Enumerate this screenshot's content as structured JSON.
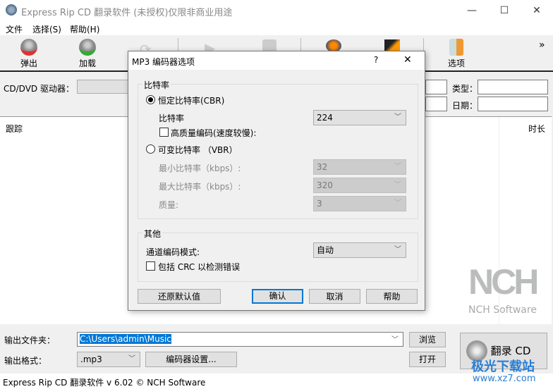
{
  "window": {
    "title": "Express Rip CD 翻录软件 (未授权)仅限非商业用途",
    "minimize": "—",
    "maximize": "☐",
    "close": "✕"
  },
  "menu": [
    "文件",
    "选择(S)",
    "帮助(H)"
  ],
  "toolbar": {
    "eject": "弹出",
    "load": "加载",
    "options": "选项",
    "more": "»"
  },
  "drive": {
    "label": "CD/DVD 驱动器：",
    "type_label": "类型：",
    "date_label": "日期："
  },
  "tracklist": {
    "col_track": "跟踪",
    "col_duration": "时长"
  },
  "brand": {
    "logo": "NCH",
    "name": "NCH Software"
  },
  "bottom": {
    "output_folder_label": "输出文件夹：",
    "output_folder_value": "C:\\Users\\admin\\Music",
    "browse": "浏览",
    "output_format_label": "输出格式：",
    "format_value": ".mp3",
    "encoder_settings": "编码器设置...",
    "open": "打开",
    "rip": "翻录 CD"
  },
  "status": "Express Rip CD 翻录软件 v 6.02 © NCH Software",
  "watermark": {
    "text": "极光下载站",
    "url": "www.xz7.com"
  },
  "dialog": {
    "title": "MP3 编码器选项",
    "help": "?",
    "close": "✕",
    "bitrate_group": "比特率",
    "cbr": "恒定比特率(CBR)",
    "cbr_selected": true,
    "bitrate_label": "比特率",
    "bitrate_value": "224",
    "high_quality": "高质量编码(速度较慢):",
    "high_quality_checked": false,
    "vbr": "可变比特率 （VBR）",
    "min_label": "最小比特率（kbps）:",
    "min_value": "32",
    "max_label": "最大比特率（kbps）:",
    "max_value": "320",
    "quality_label": "质量:",
    "quality_value": "3",
    "other_group": "其他",
    "channel_label": "通道编码模式:",
    "channel_value": "自动",
    "crc": "包括 CRC 以检测错误",
    "crc_checked": false,
    "restore": "还原默认值",
    "ok": "确认",
    "cancel": "取消",
    "help_btn": "帮助"
  }
}
